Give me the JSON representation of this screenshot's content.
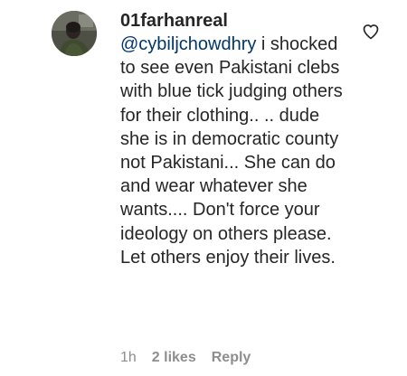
{
  "comment": {
    "username": "01farhanreal",
    "mention": "@cybiljchowdhry",
    "text": " i shocked to see even Pakistani clebs with blue tick judging others for their clothing.. .. dude she is in democratic county not Pakistani... She can do and wear whatever she wants.... Don't force your ideology on others please. Let others enjoy their lives.",
    "time": "1h",
    "likes": "2 likes",
    "reply_label": "Reply",
    "like_icon": "heart-outline-icon",
    "colors": {
      "text": "#262626",
      "mention": "#00376b",
      "meta": "#8e8e8e"
    }
  }
}
